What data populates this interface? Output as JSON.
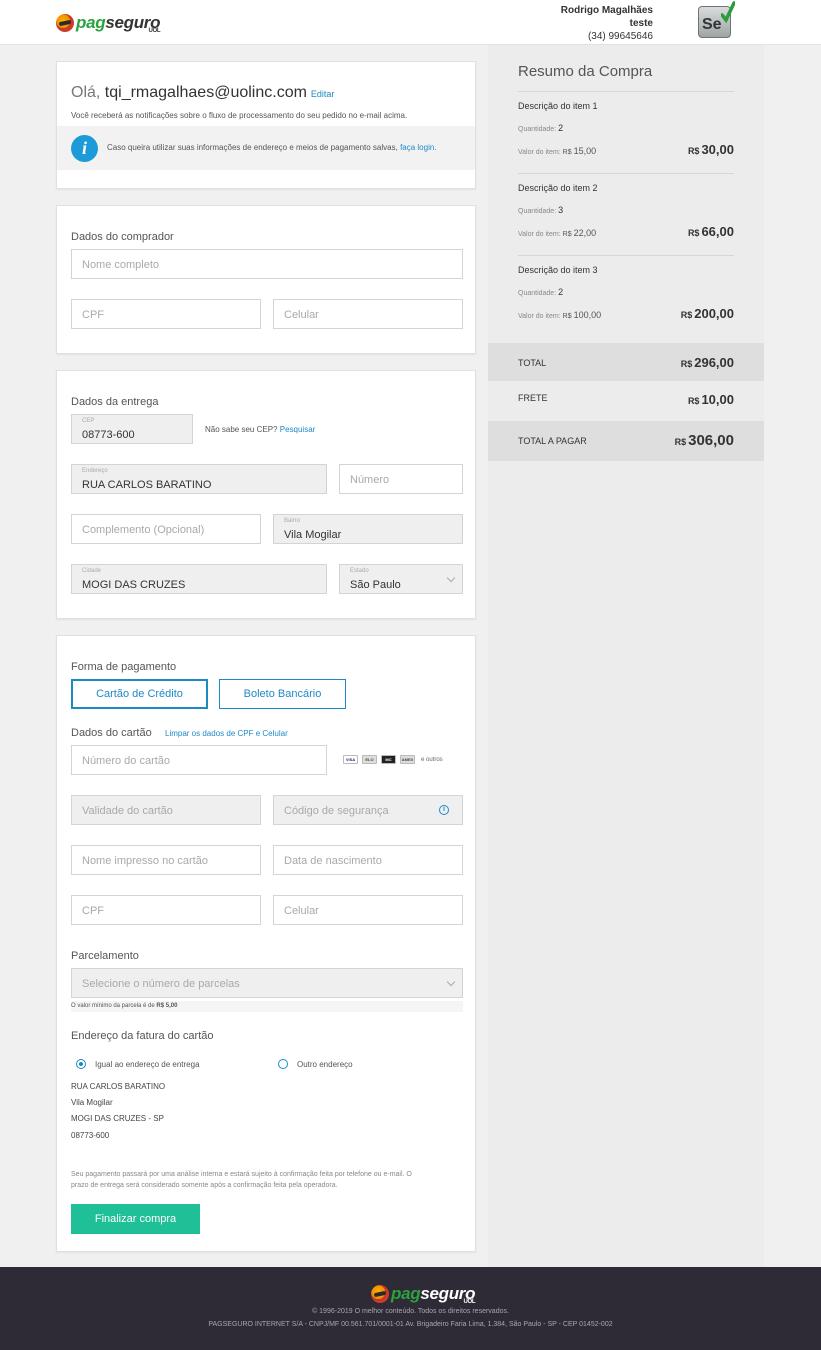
{
  "brand": {
    "logo_pag": "pag",
    "logo_seg": "seguro",
    "logo_uol": "UOL",
    "accent": "#1d8ac6",
    "green": "#1fbf98"
  },
  "header": {
    "user_name": "Rodrigo Magalhães",
    "user_tag": "teste",
    "user_phone": "(34) 99645646",
    "se_icon_text": "Se"
  },
  "greeting": {
    "hello": "Olá,",
    "email": "tqi_rmagalhaes@uolinc.com",
    "edit_link": "Editar",
    "notice": "Você receberá as notificações sobre o fluxo de processamento do seu pedido no e-mail acima.",
    "info_icon": "i",
    "info_text": "Caso queira utilizar suas informações de endereço e meios de pagamento salvas,",
    "login_link": "faça login."
  },
  "buyer": {
    "title": "Dados do comprador",
    "name_placeholder": "Nome completo",
    "cpf_placeholder": "CPF",
    "phone_placeholder": "Celular"
  },
  "delivery": {
    "title": "Dados da entrega",
    "cep_label": "CEP",
    "cep_value": "08773-600",
    "cep_help": "Não sabe seu CEP?",
    "cep_search": "Pesquisar",
    "street_label": "Endereço",
    "street_value": "RUA CARLOS BARATINO",
    "number_placeholder": "Número",
    "complement_placeholder": "Complemento (Opcional)",
    "district_label": "Bairro",
    "district_value": "Vila Mogilar",
    "city_label": "Cidade",
    "city_value": "MOGI DAS CRUZES",
    "state_label": "Estado",
    "state_value": "São Paulo"
  },
  "payment": {
    "title": "Forma de pagamento",
    "tab_card": "Cartão de Crédito",
    "tab_boleto": "Boleto Bancário",
    "card_title": "Dados do cartão",
    "clear_link": "Limpar os dados de CPF e Celular",
    "card_number_placeholder": "Número do cartão",
    "brand_visa": "VISA",
    "brand_2": "ELO",
    "brand_3": "MC",
    "brand_4": "AMEX",
    "brands_more": "e outros",
    "expiry_placeholder": "Validade do cartão",
    "cvv_placeholder": "Código de segurança",
    "cvv_icon": "i",
    "holder_placeholder": "Nome impresso no cartão",
    "birth_placeholder": "Data de nascimento",
    "cpf_placeholder": "CPF",
    "phone_placeholder": "Celular",
    "installments_title": "Parcelamento",
    "installments_placeholder": "Selecione o número de parcelas",
    "min_note_prefix": "O valor mínimo da parcela é de",
    "min_note_value": "R$ 5,00",
    "billing_title": "Endereço da fatura do cartão",
    "billing_same": "Igual ao endereço de entrega",
    "billing_other": "Outro endereço",
    "billing_address": [
      "RUA CARLOS BARATINO",
      "Vila Mogilar",
      "MOGI DAS CRUZES - SP",
      "08773-600"
    ],
    "disclaimer": "Seu pagamento passará por uma análise interna e estará sujeito à confirmação feita por telefone ou e-mail. O prazo de entrega será considerado somente após a confirmação feita pela operadora.",
    "finalize": "Finalizar compra"
  },
  "summary": {
    "title": "Resumo da Compra",
    "qty_label": "Quantidade:",
    "unit_label": "Valor do item:",
    "currency": "R$",
    "items": [
      {
        "name": "Descrição do item 1",
        "qty": "2",
        "unit": "15,00",
        "total": "30,00"
      },
      {
        "name": "Descrição do item 2",
        "qty": "3",
        "unit": "22,00",
        "total": "66,00"
      },
      {
        "name": "Descrição do item 3",
        "qty": "2",
        "unit": "100,00",
        "total": "200,00"
      }
    ],
    "total_label": "TOTAL",
    "total_value": "296,00",
    "shipping_label": "FRETE",
    "shipping_value": "10,00",
    "grand_label": "TOTAL A PAGAR",
    "grand_value": "306,00"
  },
  "footer": {
    "copyright": "© 1996-2019 O melhor conteúdo. Todos os direitos reservados.",
    "legal": "PAGSEGURO INTERNET S/A - CNPJ/MF 00.561.701/0001-01 Av. Brigadeiro Faria Lima, 1.384, São Paulo - SP - CEP 01452-002"
  }
}
